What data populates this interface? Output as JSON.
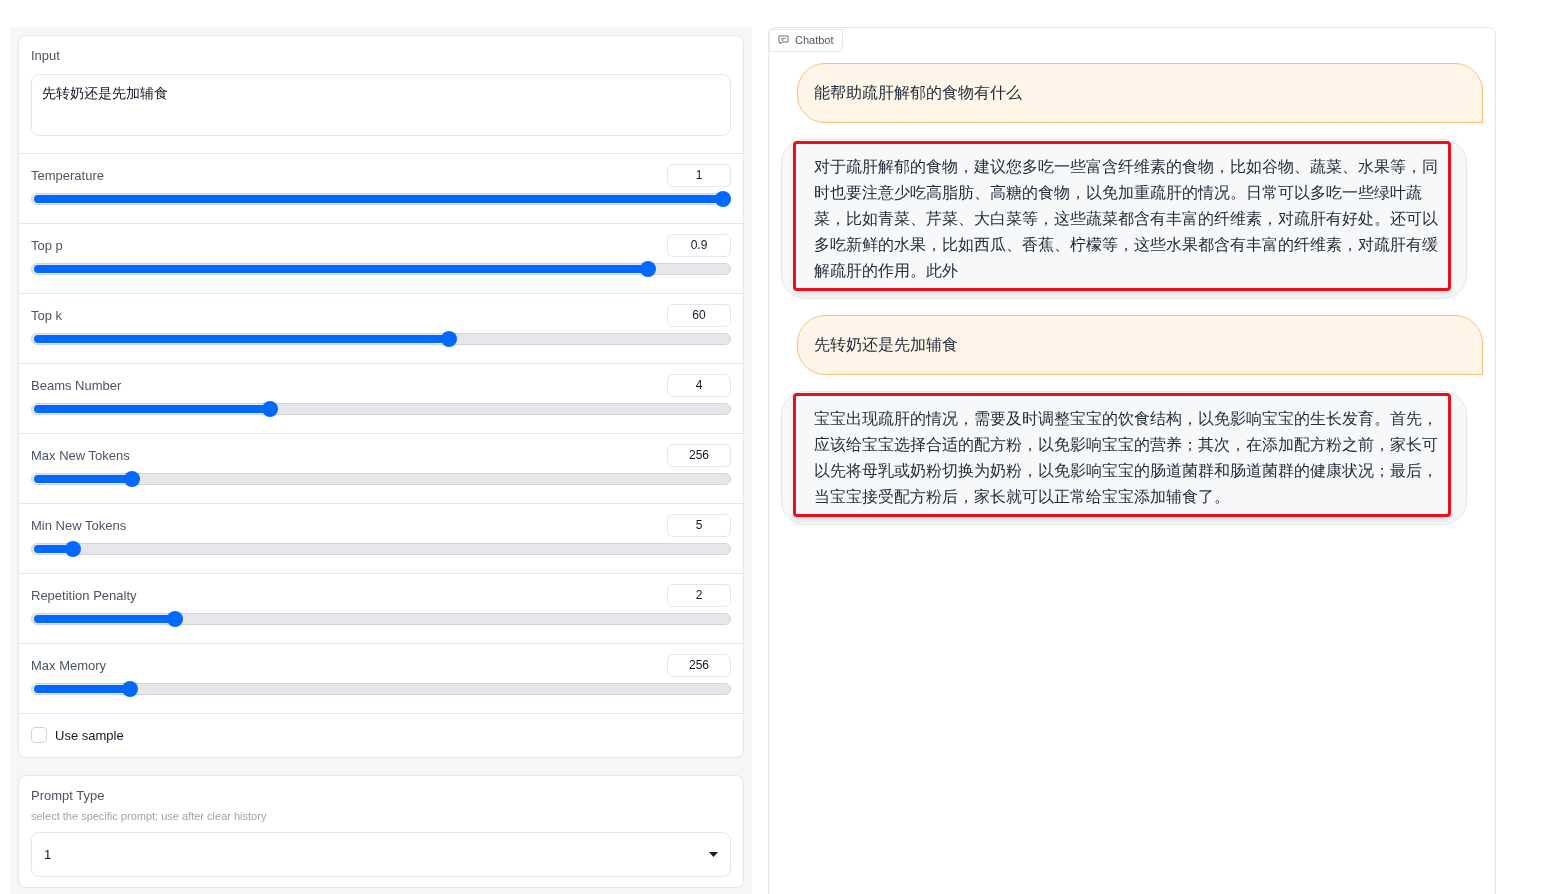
{
  "input": {
    "label": "Input",
    "value": "先转奶还是先加辅食"
  },
  "sliders": [
    {
      "label": "Temperature",
      "value": "1",
      "level": 1
    },
    {
      "label": "Top p",
      "value": "0.9",
      "level": 0.89
    },
    {
      "label": "Top k",
      "value": "60",
      "level": 0.6
    },
    {
      "label": "Beams Number",
      "value": "4",
      "level": 0.337
    },
    {
      "label": "Max New Tokens",
      "value": "256",
      "level": 0.136
    },
    {
      "label": "Min New Tokens",
      "value": "5",
      "level": 0.05
    },
    {
      "label": "Repetition Penalty",
      "value": "2",
      "level": 0.199
    },
    {
      "label": "Max Memory",
      "value": "256",
      "level": 0.133
    }
  ],
  "use_sample": {
    "label": "Use sample",
    "checked": false
  },
  "prompt_type": {
    "label": "Prompt Type",
    "hint": "select the specific prompt; use after clear history",
    "value": "1"
  },
  "chatbot": {
    "label": "Chatbot",
    "messages": [
      {
        "kind": "user",
        "text": "能帮助疏肝解郁的食物有什么",
        "highlighted": false
      },
      {
        "kind": "bot",
        "text": "对于疏肝解郁的食物，建议您多吃一些富含纤维素的食物，比如谷物、蔬菜、水果等，同时也要注意少吃高脂肪、高糖的食物，以免加重疏肝的情况。日常可以多吃一些绿叶蔬菜，比如青菜、芹菜、大白菜等，这些蔬菜都含有丰富的纤维素，对疏肝有好处。还可以多吃新鲜的水果，比如西瓜、香蕉、柠檬等，这些水果都含有丰富的纤维素，对疏肝有缓解疏肝的作用。此外",
        "highlighted": true
      },
      {
        "kind": "user",
        "text": "先转奶还是先加辅食",
        "highlighted": false
      },
      {
        "kind": "bot",
        "text": "宝宝出现疏肝的情况，需要及时调整宝宝的饮食结构，以免影响宝宝的生长发育。首先，应该给宝宝选择合适的配方粉，以免影响宝宝的营养；其次，在添加配方粉之前，家长可以先将母乳或奶粉切换为奶粉，以免影响宝宝的肠道菌群和肠道菌群的健康状况；最后，当宝宝接受配方粉后，家长就可以正常给宝宝添加辅食了。",
        "highlighted": true
      }
    ]
  }
}
